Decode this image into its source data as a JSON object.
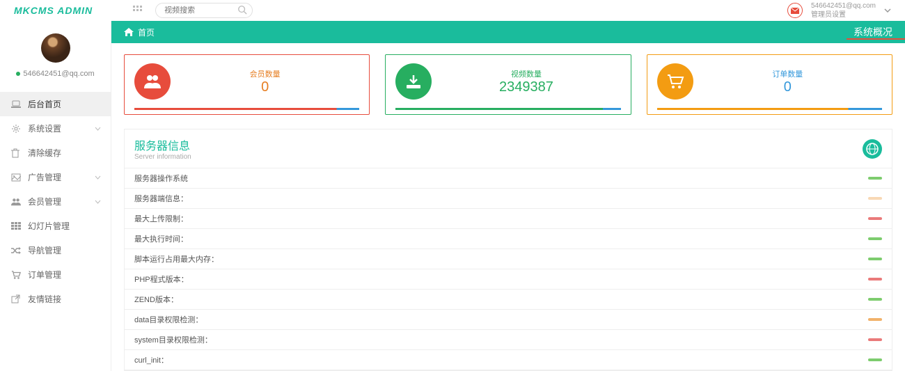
{
  "brand": "MKCMS ADMIN",
  "search": {
    "placeholder": "视频搜索"
  },
  "user": {
    "email": "546642451@qq.com",
    "role": "管理员设置"
  },
  "breadcrumb": {
    "home": "首页",
    "right": "系统概况"
  },
  "sidebar": {
    "email": "546642451@qq.com",
    "items": [
      {
        "label": "后台首页",
        "active": true,
        "icon": "laptop"
      },
      {
        "label": "系统设置",
        "icon": "cog",
        "arrow": true
      },
      {
        "label": "清除缓存",
        "icon": "trash"
      },
      {
        "label": "广告管理",
        "icon": "image",
        "arrow": true
      },
      {
        "label": "会员管理",
        "icon": "users",
        "arrow": true
      },
      {
        "label": "幻灯片管理",
        "icon": "th"
      },
      {
        "label": "导航管理",
        "icon": "random"
      },
      {
        "label": "订单管理",
        "icon": "cart"
      },
      {
        "label": "友情链接",
        "icon": "external"
      }
    ]
  },
  "cards": [
    {
      "label": "会员数量",
      "value": "0",
      "color": "red",
      "icon": "users"
    },
    {
      "label": "视频数量",
      "value": "2349387",
      "color": "green",
      "icon": "download"
    },
    {
      "label": "订单数量",
      "value": "0",
      "color": "orange",
      "icon": "cart"
    }
  ],
  "server": {
    "title": "服务器信息",
    "subtitle": "Server information",
    "rows": [
      {
        "label": "服务器操作系统",
        "badge": "",
        "bclass": "g"
      },
      {
        "label": "服务器端信息：",
        "badge": "",
        "bclass": "o faded"
      },
      {
        "label": "最大上传限制：",
        "badge": "",
        "bclass": "r"
      },
      {
        "label": "最大执行时间：",
        "badge": "",
        "bclass": "g"
      },
      {
        "label": "脚本运行占用最大内存：",
        "badge": "",
        "bclass": "g"
      },
      {
        "label": "PHP程式版本：",
        "badge": "",
        "bclass": "r"
      },
      {
        "label": "ZEND版本：",
        "badge": "",
        "bclass": "g"
      },
      {
        "label": "data目录权限检测：",
        "badge": "",
        "bclass": "o"
      },
      {
        "label": "system目录权限检测：",
        "badge": "",
        "bclass": "r"
      },
      {
        "label": "curl_init：",
        "badge": "",
        "bclass": "g"
      }
    ]
  }
}
